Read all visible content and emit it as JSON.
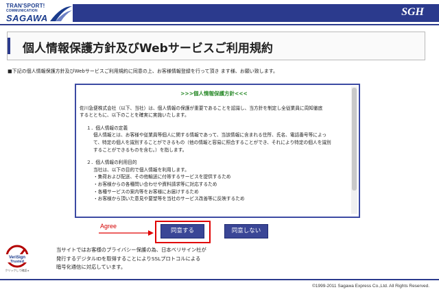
{
  "brand": {
    "line1": "TRAN'SPORT!",
    "line2": "COMMUNICATION",
    "line3": "SAGAWA",
    "mark": "SGH"
  },
  "page": {
    "title": "個人情報保護方針及びWebサービスご利用規約",
    "intro": "■下記の個人情報保護方針及びWebサービスご利用規約に同意の上、お客様情報登録を行って頂き ます様、お願い致します。"
  },
  "terms": {
    "heading": ">>>個人情報保護方針<<<",
    "para1_line1": "佐川急便株式会社（以下、当社）は、個人情報の保護が重要であることを認識し、当方針を制定し全従業員に周知徹底",
    "para1_line2": "するとともに、以下のことを確実に実施いたします。",
    "sec1_title": "１．個人情報の定義",
    "sec1_l1": "個人情報とは、お客様や従業員等個人に関する情報であって、当該情報に含まれる住所、氏名、電話番号等によっ",
    "sec1_l2": "て、特定の個人を識別することができるもの（他の情報と容易に照合することができ、それにより特定の個人を識別",
    "sec1_l3": "することができるものを含む。）を指します。",
    "sec2_title": "２．個人情報の利用目的",
    "sec2_l1": "当社は、以下の目的で個人情報を利用します。",
    "sec2_items": [
      "・集荷および配送、その他輸送に付帯するサービスを提供するため",
      "・お客様からの各種問い合わせや資料請求等に対応するため",
      "・各種サービスの案内等をお客様にお届けするため",
      "・お客様から頂いた意見や要望等を当社のサービス改善等に反映するため"
    ]
  },
  "actions": {
    "agree_annotation": "Agree",
    "agree": "同意する",
    "disagree": "同意しない"
  },
  "verisign": {
    "brand1": "VeriSign",
    "brand2": "Trusted",
    "click": "クリックして確認 ▸",
    "line1": "当サイトではお客様のプライバシー保護の為、日本ベリサイン社が",
    "line2": "発行するデジタルIDを取得することによりSSLプロトコルによる",
    "line3": "暗号化通信に対応しています。"
  },
  "footer": {
    "copyright": "©1999-2011 Sagawa Express Co.,Ltd. All Rights Reserved."
  },
  "colors": {
    "brand_blue": "#2b3a8d",
    "button_blue": "#3a4696",
    "highlight_red": "#e00000",
    "heading_green": "#2a8a2a"
  }
}
